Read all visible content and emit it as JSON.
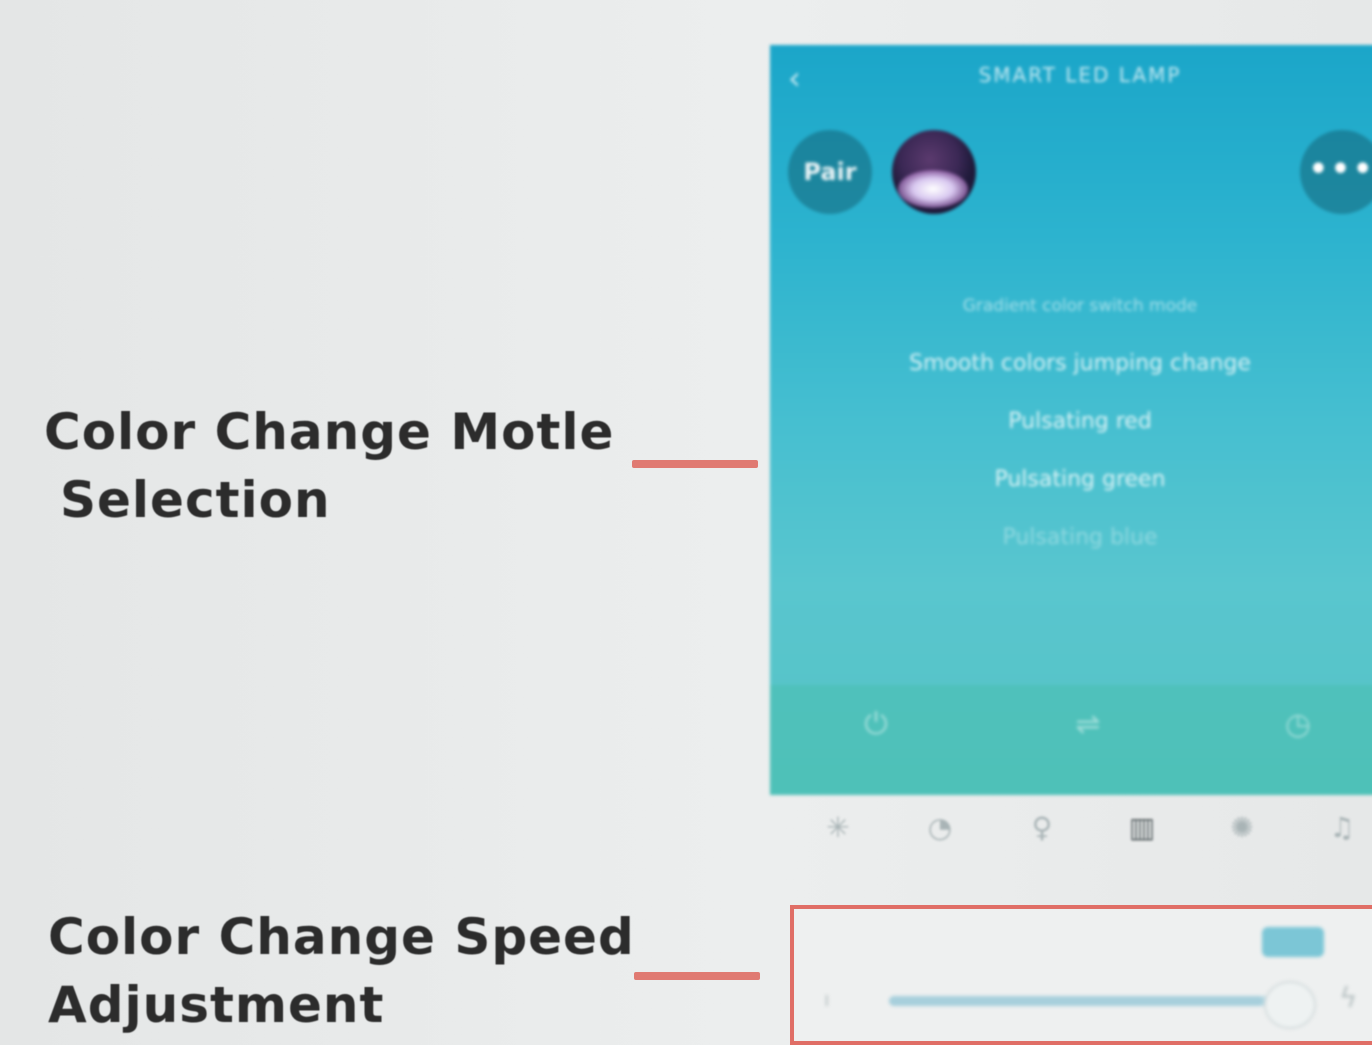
{
  "callouts": {
    "mode_label_line1": "Color Change Motle",
    "mode_label_line2": "Selection",
    "speed_label_line1": "Color Change Speed",
    "speed_label_line2": "Adjustment"
  },
  "phone": {
    "title": "SMART LED LAMP",
    "back_icon": "‹",
    "pair_label": "Pair",
    "more_label": "•••",
    "mode_list": [
      "Gradient color switch mode",
      "Smooth colors jumping change",
      "Pulsating red",
      "Pulsating green",
      "Pulsating blue"
    ],
    "bottom_icons": [
      {
        "name": "power-icon",
        "glyph": "⏻"
      },
      {
        "name": "mode-icon",
        "glyph": "⇌"
      },
      {
        "name": "timer-icon",
        "glyph": "◷"
      }
    ]
  },
  "tabbar": {
    "items": [
      {
        "name": "sun-icon",
        "glyph": "✳"
      },
      {
        "name": "palette-icon",
        "glyph": "◔"
      },
      {
        "name": "bulb-icon",
        "glyph": "♀"
      },
      {
        "name": "modes-icon",
        "glyph": "▥"
      },
      {
        "name": "sparkle-icon",
        "glyph": "✺"
      },
      {
        "name": "music-icon",
        "glyph": "♫"
      }
    ],
    "active_index": 3
  },
  "speed": {
    "level_fraction": 0.96,
    "slow_glyph": "ı",
    "fast_glyph": "ϟ"
  },
  "colors": {
    "accent_red": "#e06e66",
    "phone_teal": "#2cb3cf"
  }
}
